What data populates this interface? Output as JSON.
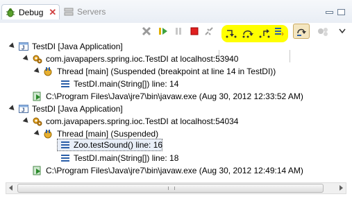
{
  "tabs": [
    {
      "label": "Debug",
      "icon": "debug-bug-icon",
      "active": true
    },
    {
      "label": "Servers",
      "icon": "servers-icon",
      "active": false
    }
  ],
  "toolbar": {
    "buttons": [
      "remove-terminated-icon",
      "resume-icon",
      "suspend-icon",
      "terminate-icon",
      "disconnect-icon",
      "step-into-icon",
      "step-over-icon",
      "step-return-icon",
      "drop-to-frame-icon",
      "use-step-filters-icon",
      "view-menu-icon"
    ],
    "highlight_color": "#ffff00"
  },
  "tree": [
    {
      "label": "TestDI [Java Application]"
    },
    {
      "label": "com.javapapers.spring.ioc.TestDI at localhost:53940"
    },
    {
      "label": "Thread [main] (Suspended (breakpoint at line 14 in TestDI))"
    },
    {
      "label": "TestDI.main(String[]) line: 14"
    },
    {
      "label": "C:\\Program Files\\Java\\jre7\\bin\\javaw.exe (Aug 30, 2012 12:33:52 AM)"
    },
    {
      "label": "TestDI [Java Application]"
    },
    {
      "label": "com.javapapers.spring.ioc.TestDI at localhost:54034"
    },
    {
      "label": "Thread [main] (Suspended)"
    },
    {
      "label": "Zoo.testSound() line: 16"
    },
    {
      "label": "TestDI.main(String[]) line: 18"
    },
    {
      "label": "C:\\Program Files\\Java\\jre7\\bin\\javaw.exe (Aug 30, 2012 12:49:14 AM)"
    }
  ]
}
